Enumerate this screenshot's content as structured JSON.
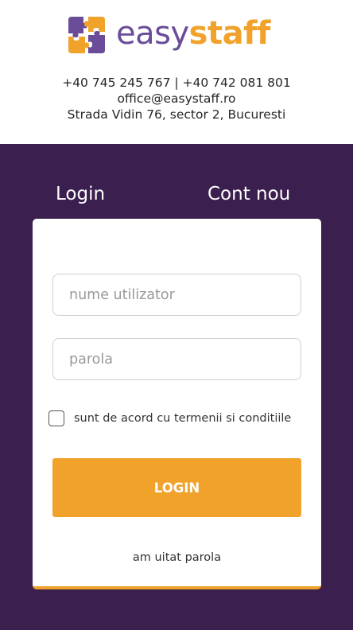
{
  "brand": {
    "part1": "easy",
    "part2": "staff",
    "color_primary": "#6a4c98",
    "color_accent": "#f0a22a"
  },
  "contact": {
    "phones": "+40 745 245 767 | +40 742 081 801",
    "email": "office@easystaff.ro",
    "address": "Strada Vidin 76, sector 2, Bucuresti"
  },
  "tabs": {
    "login": "Login",
    "register": "Cont nou"
  },
  "form": {
    "username_placeholder": "nume utilizator",
    "username_value": "",
    "password_placeholder": "parola",
    "password_value": "",
    "terms_label": "sunt de acord cu termenii si conditiile",
    "terms_checked": false,
    "submit_label": "LOGIN",
    "forgot_label": "am uitat parola"
  },
  "colors": {
    "panel_bg": "#3b1f4e",
    "button_bg": "#f0a22a"
  },
  "icons": [
    "puzzle-logo-icon",
    "checkbox-icon"
  ]
}
